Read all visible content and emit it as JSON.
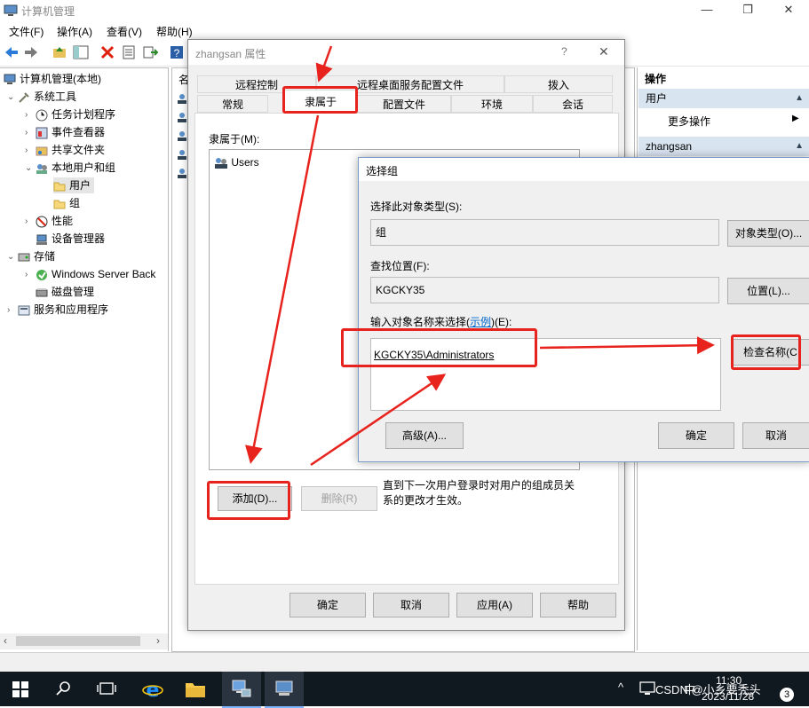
{
  "window": {
    "title": "计算机管理",
    "controls": [
      "—",
      "❐",
      "✕"
    ]
  },
  "menu": [
    "文件(F)",
    "操作(A)",
    "查看(V)",
    "帮助(H)"
  ],
  "tree": {
    "root": "计算机管理(本地)",
    "system_tools": "系统工具",
    "task_scheduler": "任务计划程序",
    "event_viewer": "事件查看器",
    "shared_folders": "共享文件夹",
    "local_users": "本地用户和组",
    "users": "用户",
    "groups": "组",
    "performance": "性能",
    "device_manager": "设备管理器",
    "storage": "存储",
    "windows_backup": "Windows Server Back",
    "disk_mgmt": "磁盘管理",
    "services_apps": "服务和应用程序"
  },
  "midpane": {
    "col_header": "名"
  },
  "actions": {
    "header": "操作",
    "section1": "用户",
    "more_actions": "更多操作",
    "section2": "zhangsan"
  },
  "props": {
    "title": "zhangsan 属性",
    "help_glyph": "?",
    "close_glyph": "✕",
    "tabs_row1": [
      "远程控制",
      "远程桌面服务配置文件",
      "拨入"
    ],
    "tabs_row2": [
      "常规",
      "隶属于",
      "配置文件",
      "环境",
      "会话"
    ],
    "member_of_label": "隶属于(M):",
    "member_item": "Users",
    "add_button": "添加(D)...",
    "remove_button": "删除(R)",
    "note": "直到下一次用户登录时对用户的组成员关系的更改才生效。",
    "ok": "确定",
    "cancel": "取消",
    "apply": "应用(A)",
    "help": "帮助"
  },
  "select_group": {
    "title": "选择组",
    "object_type_label": "选择此对象类型(S):",
    "object_type_value": "组",
    "object_type_button": "对象类型(O)...",
    "location_label": "查找位置(F):",
    "location_value": "KGCKY35",
    "location_button": "位置(L)...",
    "enter_names_label_pre": "输入对象名称来选择(",
    "enter_names_link": "示例",
    "enter_names_label_post": ")(E):",
    "enter_names_value": "KGCKY35\\Administrators",
    "check_names_button": "检查名称(C",
    "advanced_button": "高级(A)...",
    "ok": "确定",
    "cancel": "取消"
  },
  "taskbar": {
    "tray_chevron": "^",
    "ime": "中",
    "time": "11:30",
    "date": "2023/11/28",
    "watermark": "CSDN @小乡要秃头",
    "notification_count": "3"
  },
  "colors": {
    "annotation_red": "#e8231d",
    "taskbar": "#101820",
    "selection_blue": "#d9e4f1"
  }
}
